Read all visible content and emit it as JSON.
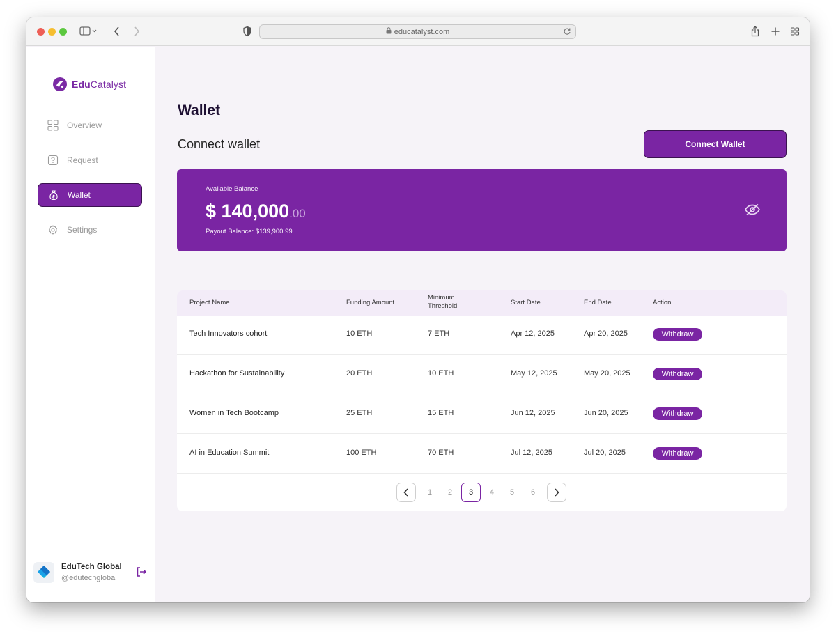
{
  "browser": {
    "url": "educatalyst.com"
  },
  "brand": {
    "name_bold": "Edu",
    "name_rest": "Catalyst",
    "color": "#7a2aa4"
  },
  "sidebar": {
    "items": [
      {
        "label": "Overview",
        "icon": "grid-icon",
        "active": false
      },
      {
        "label": "Request",
        "icon": "question-icon",
        "active": false
      },
      {
        "label": "Wallet",
        "icon": "money-bag-icon",
        "active": true
      },
      {
        "label": "Settings",
        "icon": "gear-icon",
        "active": false
      }
    ],
    "profile": {
      "name": "EduTech Global",
      "handle": "@edutechglobal"
    }
  },
  "main": {
    "page_title": "Wallet",
    "section_title": "Connect wallet",
    "connect_button": "Connect Wallet",
    "balance": {
      "label": "Available Balance",
      "amount": "$ 140,000",
      "cents": ".00",
      "payout": "Payout Balance: $139,900.99"
    },
    "table": {
      "columns": [
        "Project Name",
        "Funding Amount",
        "Minimum Threshold",
        "Start Date",
        "End Date",
        "Action"
      ],
      "rows": [
        {
          "name": "Tech Innovators cohort",
          "funding": "10 ETH",
          "threshold": "7 ETH",
          "start": "Apr 12, 2025",
          "end": "Apr 20, 2025",
          "action": "Withdraw"
        },
        {
          "name": "Hackathon for Sustainability",
          "funding": "20 ETH",
          "threshold": "10 ETH",
          "start": "May 12, 2025",
          "end": "May 20, 2025",
          "action": "Withdraw"
        },
        {
          "name": "Women in Tech Bootcamp",
          "funding": "25 ETH",
          "threshold": "15 ETH",
          "start": "Jun 12, 2025",
          "end": "Jun 20, 2025",
          "action": "Withdraw"
        },
        {
          "name": "AI in Education Summit",
          "funding": "100 ETH",
          "threshold": "70 ETH",
          "start": "Jul 12, 2025",
          "end": "Jul 20, 2025",
          "action": "Withdraw"
        }
      ]
    },
    "pagination": {
      "pages": [
        "1",
        "2",
        "3",
        "4",
        "5",
        "6"
      ],
      "current": "3"
    }
  },
  "colors": {
    "accent": "#7a25a3",
    "background": "#f6f3f8",
    "table_header": "#f3ecf8"
  }
}
